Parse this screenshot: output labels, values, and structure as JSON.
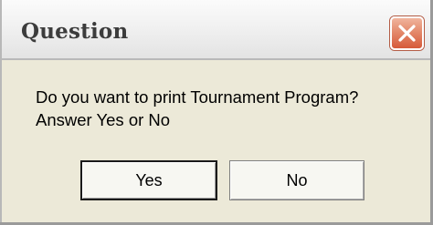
{
  "window": {
    "title": "Question",
    "close_icon": "close-x-icon",
    "colors": {
      "close_button": "#e0775a",
      "dialog_bg": "#ece9d8"
    }
  },
  "message": {
    "line1": "Do you want to print Tournament Program?",
    "line2": "Answer Yes or No"
  },
  "buttons": {
    "yes_label": "Yes",
    "no_label": "No"
  }
}
